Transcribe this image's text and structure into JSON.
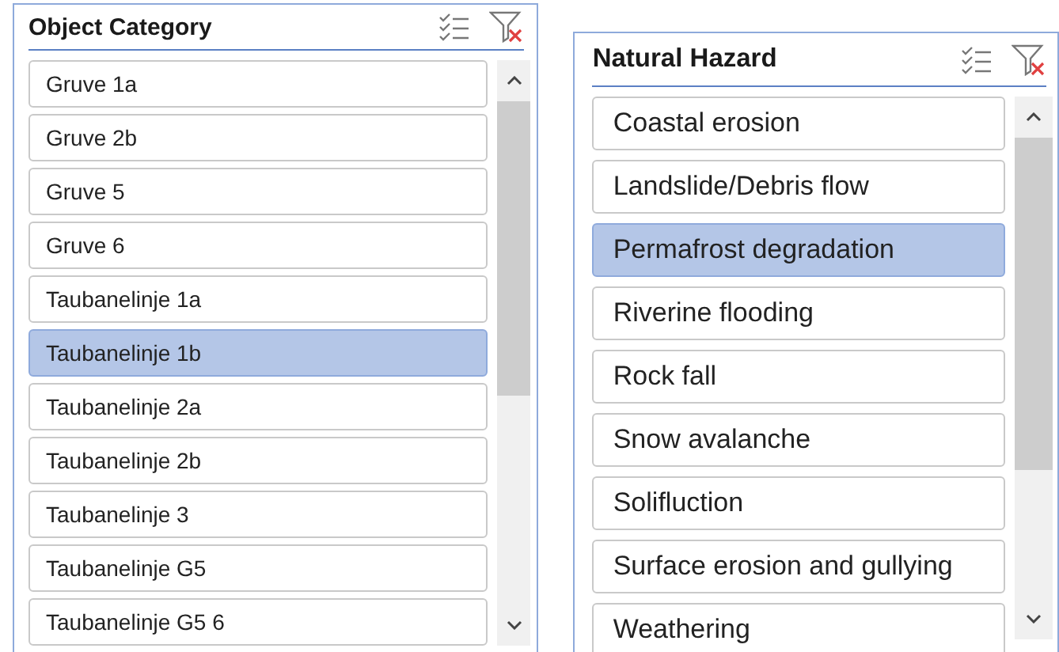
{
  "slicers": [
    {
      "title": "Object Category",
      "items": [
        {
          "label": "Gruve 1a",
          "selected": false
        },
        {
          "label": "Gruve 2b",
          "selected": false
        },
        {
          "label": "Gruve 5",
          "selected": false
        },
        {
          "label": "Gruve 6",
          "selected": false
        },
        {
          "label": "Taubanelinje 1a",
          "selected": false
        },
        {
          "label": "Taubanelinje 1b",
          "selected": true
        },
        {
          "label": "Taubanelinje 2a",
          "selected": false
        },
        {
          "label": "Taubanelinje 2b",
          "selected": false
        },
        {
          "label": "Taubanelinje 3",
          "selected": false
        },
        {
          "label": "Taubanelinje G5",
          "selected": false
        },
        {
          "label": "Taubanelinje G5 6",
          "selected": false
        }
      ]
    },
    {
      "title": "Natural Hazard",
      "items": [
        {
          "label": "Coastal erosion",
          "selected": false
        },
        {
          "label": "Landslide/Debris flow",
          "selected": false
        },
        {
          "label": "Permafrost degradation",
          "selected": true
        },
        {
          "label": "Riverine flooding",
          "selected": false
        },
        {
          "label": "Rock fall",
          "selected": false
        },
        {
          "label": "Snow avalanche",
          "selected": false
        },
        {
          "label": "Solifluction",
          "selected": false
        },
        {
          "label": "Surface erosion and gullying",
          "selected": false
        },
        {
          "label": "Weathering",
          "selected": false
        }
      ]
    }
  ]
}
